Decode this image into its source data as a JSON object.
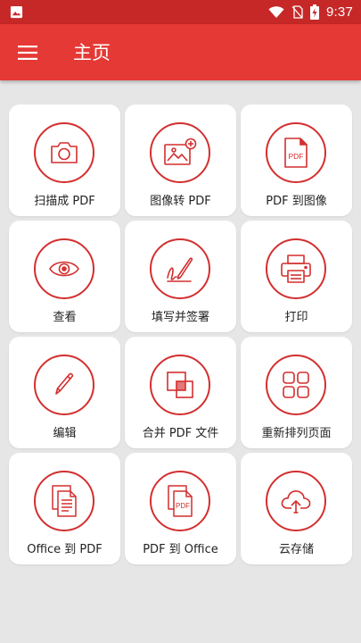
{
  "status_bar": {
    "time": "9:37",
    "icons": [
      "image-icon",
      "wifi-icon",
      "no-sim-icon",
      "battery-charging-icon"
    ]
  },
  "app_bar": {
    "title": "主页",
    "menu_icon": "hamburger-menu-icon"
  },
  "tiles": [
    {
      "label": "扫描成 PDF",
      "icon": "camera-icon"
    },
    {
      "label": "图像转 PDF",
      "icon": "image-add-icon"
    },
    {
      "label": "PDF 到图像",
      "icon": "pdf-file-icon"
    },
    {
      "label": "查看",
      "icon": "eye-icon"
    },
    {
      "label": "填写并签署",
      "icon": "signature-pen-icon"
    },
    {
      "label": "打印",
      "icon": "printer-icon"
    },
    {
      "label": "编辑",
      "icon": "pencil-icon"
    },
    {
      "label": "合并 PDF 文件",
      "icon": "merge-icon"
    },
    {
      "label": "重新排列页面",
      "icon": "grid-reorder-icon"
    },
    {
      "label": "Office 到 PDF",
      "icon": "office-document-icon"
    },
    {
      "label": "PDF 到 Office",
      "icon": "pdf-stack-icon"
    },
    {
      "label": "云存储",
      "icon": "cloud-upload-icon"
    }
  ],
  "colors": {
    "status_bar": "#c62828",
    "app_bar": "#e53935",
    "accent": "#d32f2f",
    "background": "#e6e6e6"
  }
}
